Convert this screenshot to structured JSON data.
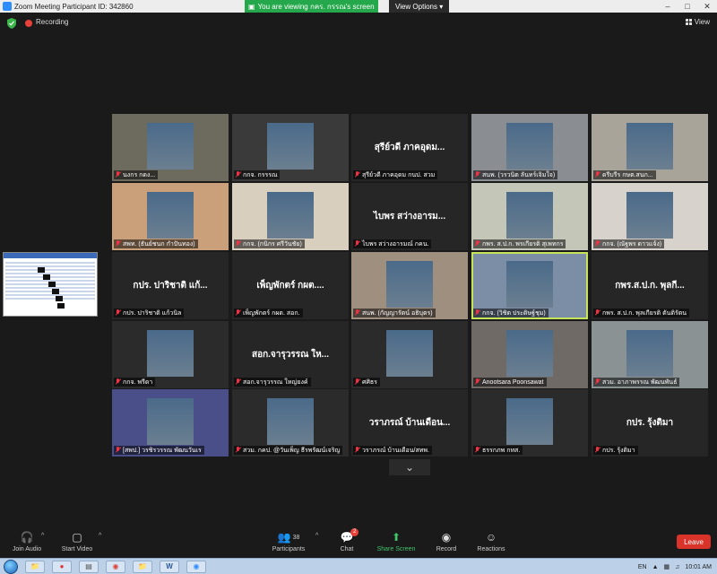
{
  "window": {
    "title": "Zoom Meeting Participant ID: 342860",
    "viewing_banner": "You are viewing กคร. กรรณ's screen",
    "view_options": "View Options ▾"
  },
  "top": {
    "recording_label": "Recording",
    "view_label": "View"
  },
  "tiles": [
    {
      "name": "นงกร กดง...",
      "big": "",
      "video": true,
      "bg": "#6d6a5e"
    },
    {
      "name": "กกจ. กรรรณ",
      "big": "",
      "video": true,
      "bg": "#3a3a3a"
    },
    {
      "name": "สุรีย์วดี ภาคอุดม กนป. สวม",
      "big": "สุรีย์วดี ภาคอุดม...",
      "video": false,
      "bg": "#262626"
    },
    {
      "name": "สนพ. (วรวนิต ลันทร์เจิมใจ)",
      "big": "",
      "video": true,
      "bg": "#8a8d92"
    },
    {
      "name": "ดรีบรีร กษต.สนก...",
      "big": "",
      "video": true,
      "bg": "#a8a49a"
    },
    {
      "name": "สพท. (ธันย์ชนก กำปันทอง)",
      "big": "",
      "video": true,
      "bg": "#c9a07a"
    },
    {
      "name": "กกจ. (กนิกร ศรีวันชัย)",
      "big": "",
      "video": true,
      "bg": "#d9cfbf"
    },
    {
      "name": "ไบพร สว่างอารมณ์ กคน.",
      "big": "ไบพร สว่างอารม...",
      "video": false,
      "bg": "#262626"
    },
    {
      "name": "กพร. ส.ป.ก. พรเกียรติ สุเพทกร",
      "big": "",
      "video": true,
      "bg": "#c4c7b8"
    },
    {
      "name": "กกจ. (ณัฐพร ดาวแจ้ง)",
      "big": "",
      "video": true,
      "bg": "#d8d2cc"
    },
    {
      "name": "กปร. ปาริชาติ แก้วนิล",
      "big": "กปร. ปาริชาติ แก้...",
      "video": false,
      "bg": "#262626"
    },
    {
      "name": "เพ็ญพักตร์ กผต. สอก.",
      "big": "เพ็ญพักตร์ กผต....",
      "video": false,
      "bg": "#262626"
    },
    {
      "name": "สนพ. (กัญญารัตน์ อธิบุตร)",
      "big": "",
      "video": true,
      "bg": "#9f8f7f"
    },
    {
      "name": "กกจ. (วิชิต ประดิษฐ์ชุม)",
      "big": "",
      "video": true,
      "bg": "#7b8ea6"
    },
    {
      "name": "กพร. ส.ป.ก. พุลเกียรติ ตันติรัตน",
      "big": "กพร.ส.ป.ก. พุลกี...",
      "video": false,
      "bg": "#262626"
    },
    {
      "name": "กกจ. พรีดา",
      "big": "",
      "video": true,
      "bg": "#2b2b2b"
    },
    {
      "name": "สอก.จารุวรรณ ใหญ่ยงค์",
      "big": "สอก.จารุวรรณ ให...",
      "video": false,
      "bg": "#262626"
    },
    {
      "name": "ศศิธร",
      "big": "",
      "video": true,
      "bg": "#2b2b2b"
    },
    {
      "name": "Anootsara Poonsawat",
      "big": "",
      "video": true,
      "bg": "#6f6a66"
    },
    {
      "name": "สวม. อาภาพรรณ พัฒนพันธ์",
      "big": "",
      "video": true,
      "bg": "#8a9293"
    },
    {
      "name": "[สพป.] วรชิรวรรณ พัฒนวันเร",
      "big": "",
      "video": true,
      "bg": "#4a4f8a"
    },
    {
      "name": "สวม. กคป. @วันเพ็ญ ธีรพรัฒน์เจริญ",
      "big": "",
      "video": true,
      "bg": "#2b2b2b"
    },
    {
      "name": "วราภรณ์ บ้านเดือน/สทพ.",
      "big": "วราภรณ์ บ้านเดือน...",
      "video": false,
      "bg": "#262626"
    },
    {
      "name": "ธรรกภพ กทส.",
      "big": "",
      "video": true,
      "bg": "#2b2b2b"
    },
    {
      "name": "กปร. รุ้งติมา",
      "big": "กปร. รุ้งติมา",
      "video": false,
      "bg": "#262626"
    }
  ],
  "toolbar": {
    "join_audio": "Join Audio",
    "start_video": "Start Video",
    "participants": "Participants",
    "participants_count": "38",
    "chat": "Chat",
    "chat_badge": "2",
    "share_screen": "Share Screen",
    "record": "Record",
    "reactions": "Reactions",
    "leave": "Leave"
  },
  "taskbar": {
    "lang": "EN",
    "clock": "10:01 AM"
  },
  "colors": {
    "banner_green": "#24a84b",
    "active_speaker": "#c7e35a",
    "leave_red": "#d9332a",
    "share_green": "#3fc46a"
  }
}
